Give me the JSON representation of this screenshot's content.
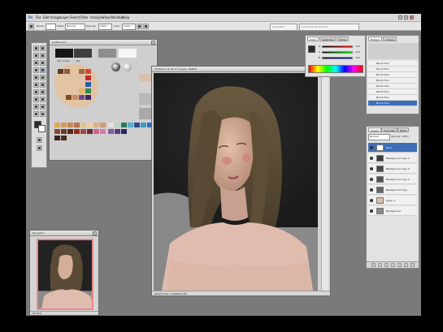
{
  "app": {
    "menu": [
      "Ps",
      "File",
      "Edit",
      "Image",
      "Layer",
      "Select",
      "Filter",
      "Analysis",
      "View",
      "Window",
      "Help"
    ],
    "workspace_label": "Essentials",
    "search_placeholder": "Computer Bookmarks"
  },
  "options_bar": {
    "brush_label": "Brush:",
    "mode_label": "Mode:",
    "mode_value": "Normal",
    "opacity_label": "Opacity:",
    "opacity_value": "100%",
    "flow_label": "Flow:",
    "flow_value": "100%"
  },
  "palette_window": {
    "title": "palette.psd",
    "label_skin": "skin tones",
    "label_hair": "hair"
  },
  "main_document": {
    "title": "Untitled-1 @ 66.7% (Layer, RGB/8)",
    "status": "66.67%   Doc: 2.00M/14.2M"
  },
  "navigator_window": {
    "title": "Navigator",
    "status": "66.67%"
  },
  "color_panel": {
    "tabs": [
      "Color",
      "Swatches",
      "Styles"
    ],
    "channels": [
      {
        "label": "R",
        "value": "150",
        "color": "#d44"
      },
      {
        "label": "G",
        "value": "120",
        "color": "#4a4"
      },
      {
        "label": "B",
        "value": "100",
        "color": "#44d"
      }
    ]
  },
  "history_panel": {
    "tabs": [
      "History",
      "Actions"
    ],
    "items": [
      "Brush Tool",
      "Brush Tool",
      "Brush Tool",
      "Brush Tool",
      "Brush Tool",
      "Brush Tool",
      "Brush Tool",
      "Brush Tool"
    ]
  },
  "layers_panel": {
    "tabs": [
      "Layers",
      "Channels",
      "Paths"
    ],
    "blend_mode": "Normal",
    "opacity": "Opacity: 100%",
    "layers": [
      {
        "name": "Face",
        "active": true
      },
      {
        "name": "Background copy 4",
        "active": false
      },
      {
        "name": "Background copy 3",
        "active": false
      },
      {
        "name": "Background copy 2",
        "active": false
      },
      {
        "name": "Background copy",
        "active": false
      },
      {
        "name": "Layer 1",
        "active": false
      },
      {
        "name": "Background",
        "active": false
      }
    ]
  },
  "colors": {
    "workspace": "#7a7a7a",
    "selection": "#3d6fb8"
  }
}
